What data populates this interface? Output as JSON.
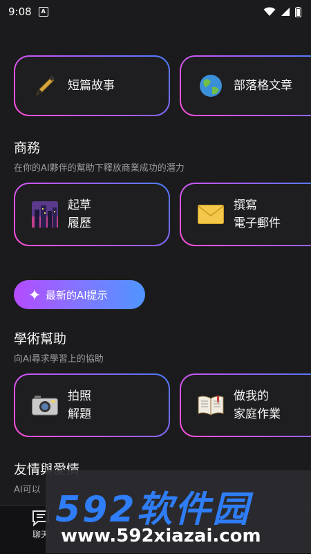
{
  "status": {
    "time": "9:08"
  },
  "top_cards": [
    {
      "label": "短篇故事",
      "icon": "pen-icon"
    },
    {
      "label": "部落格文章",
      "icon": "globe-icon"
    }
  ],
  "business": {
    "title": "商務",
    "subtitle": "在你的AI夥伴的幫助下釋放商業成功的潛力",
    "cards": [
      {
        "line1": "起草",
        "line2": "履歷",
        "icon": "city-icon"
      },
      {
        "line1": "撰寫",
        "line2": "電子郵件",
        "icon": "envelope-icon"
      }
    ]
  },
  "promo": {
    "label": "最新的AI提示",
    "icon": "sparkle-icon"
  },
  "academic": {
    "title": "學術幫助",
    "subtitle": "向AI尋求學習上的協助",
    "cards": [
      {
        "line1": "拍照",
        "line2": "解題",
        "icon": "camera-icon"
      },
      {
        "line1": "做我的",
        "line2": "家庭作業",
        "icon": "book-icon"
      }
    ]
  },
  "friendship": {
    "title": "友情與愛情",
    "subtitle": "AI可以"
  },
  "bottom_nav": {
    "chat_label": "聊天"
  },
  "watermark": {
    "brand": "592软件园",
    "url": "www.592xiazai.com"
  }
}
